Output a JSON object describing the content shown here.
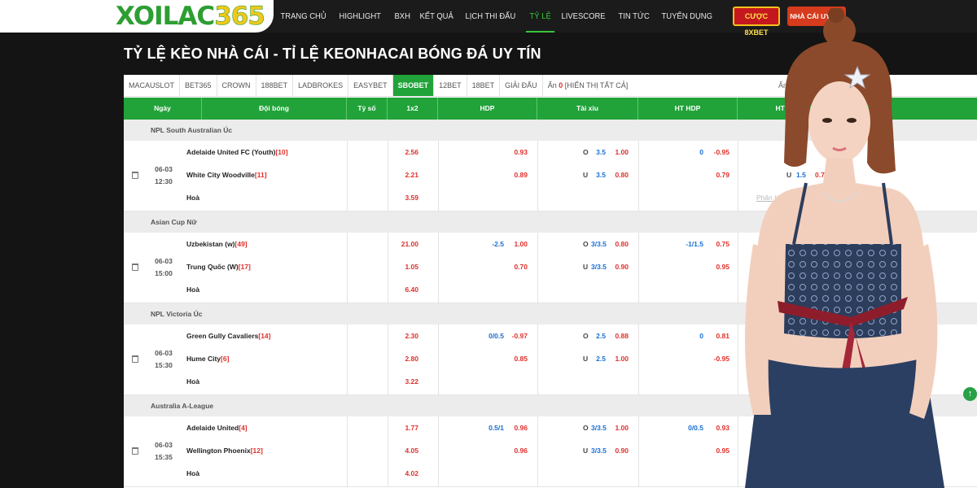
{
  "header": {
    "logo_part1": "XOILAC",
    "logo_part2": "365",
    "nav": [
      "TRANG CHỦ",
      "HIGHLIGHT",
      "BXH",
      "KẾT QUẢ",
      "LỊCH THI ĐẤU",
      "TỶ LỆ",
      "LIVESCORE",
      "TIN TỨC",
      "TUYỂN DỤNG"
    ],
    "active_nav": "TỶ LỆ",
    "cta_bet": "CƯỢC 8XBET",
    "cta_nhacai": "NHÀ CÁI UY TÍN"
  },
  "page_title": "TỶ LỆ KÈO NHÀ CÁI - TỈ LỆ KEONHACAI BÓNG ĐÁ UY TÍN",
  "tabs": [
    "MACAUSLOT",
    "BET365",
    "CROWN",
    "188BET",
    "LADBROKES",
    "EASYBET",
    "SBOBET",
    "12BET",
    "18BET",
    "GIẢI ĐẤU"
  ],
  "active_tab": "SBOBET",
  "hidden": {
    "label": "Ẩn",
    "count": "0",
    "show_all": "[HIỂN THỊ TẤT CẢ]"
  },
  "right_label": "Ẩn",
  "columns": [
    "Ngày",
    "Đội bóng",
    "Tỷ số",
    "1x2",
    "HDP",
    "Tài xỉu",
    "HT HDP",
    "HT Tài"
  ],
  "draw_label": "Hoà",
  "analysis_label": "Phân tích",
  "leagues": [
    {
      "name": "NPL South Australian Úc",
      "date": "06-03",
      "time": "12:30",
      "home": "Adelaide United FC (Youth)",
      "home_rank": "[10]",
      "away": "White City Woodville",
      "away_rank": "[11]",
      "x12": [
        "2.56",
        "2.21",
        "3.59"
      ],
      "hdp": [
        "",
        "0.93",
        "",
        "0.89"
      ],
      "tx": [
        "O",
        "3.5",
        "1.00",
        "U",
        "3.5",
        "0.80"
      ],
      "hthdp": [
        "0",
        "-0.95",
        "",
        "0.79"
      ],
      "httx": [
        "O",
        "1.5",
        "",
        "U",
        "1.5",
        "0.78"
      ],
      "has_analysis": true
    },
    {
      "name": "Asian Cup Nữ",
      "date": "06-03",
      "time": "15:00",
      "home": "Uzbekistan (w)",
      "home_rank": "[49]",
      "away": "Trung Quốc (W)",
      "away_rank": "[17]",
      "x12": [
        "21.00",
        "1.05",
        "6.40"
      ],
      "hdp": [
        "-2.5",
        "1.00",
        "",
        "0.70"
      ],
      "tx": [
        "O",
        "3/3.5",
        "0.80",
        "U",
        "3/3.5",
        "0.90"
      ],
      "hthdp": [
        "-1/1.5",
        "0.75",
        "",
        "0.95"
      ],
      "httx": [
        "",
        "",
        "",
        "",
        "",
        ""
      ],
      "has_analysis": true
    },
    {
      "name": "NPL Victoria Úc",
      "date": "06-03",
      "time": "15:30",
      "home": "Green Gully Cavaliers",
      "home_rank": "[14]",
      "away": "Hume City",
      "away_rank": "[6]",
      "x12": [
        "2.30",
        "2.80",
        "3.22"
      ],
      "hdp": [
        "0/0.5",
        "-0.97",
        "",
        "0.85"
      ],
      "tx": [
        "O",
        "2.5",
        "0.88",
        "U",
        "2.5",
        "1.00"
      ],
      "hthdp": [
        "0",
        "0.81",
        "",
        "-0.95"
      ],
      "httx": [
        "",
        "",
        "",
        "",
        "",
        ""
      ],
      "has_analysis": false
    },
    {
      "name": "Australia A-League",
      "date": "06-03",
      "time": "15:35",
      "home": "Adelaide United",
      "home_rank": "[4]",
      "away": "Wellington Phoenix",
      "away_rank": "[12]",
      "x12": [
        "1.77",
        "4.05",
        "4.02"
      ],
      "hdp": [
        "0.5/1",
        "0.96",
        "",
        "0.96"
      ],
      "tx": [
        "O",
        "3/3.5",
        "1.00",
        "U",
        "3/3.5",
        "0.90"
      ],
      "hthdp": [
        "0/0.5",
        "0.93",
        "",
        "0.95"
      ],
      "httx": [
        "",
        "",
        "",
        "",
        "",
        ""
      ],
      "has_analysis": false
    }
  ],
  "colors": {
    "green": "#21a33a",
    "red": "#e0302b",
    "blue": "#1a6fd1",
    "gold": "#f2c81a"
  },
  "icons": {
    "delete": "trash-icon",
    "scroll_top": "arrow-up-icon"
  }
}
